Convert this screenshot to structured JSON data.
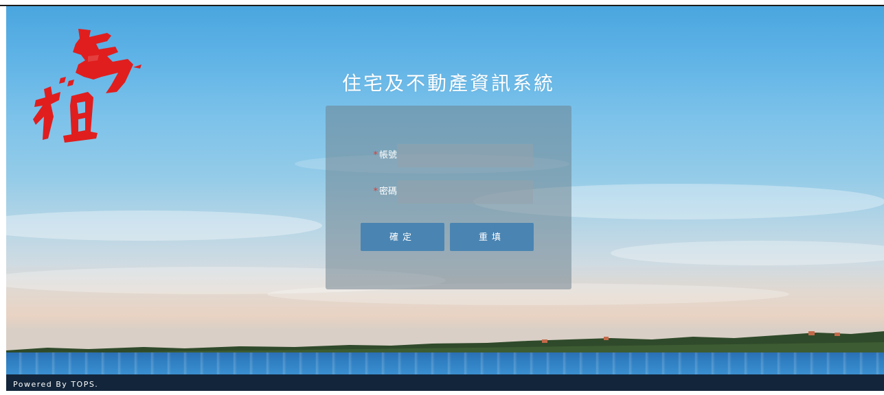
{
  "header": {
    "logo_text": "馬祖",
    "system_title": "住宅及不動產資訊系統"
  },
  "login_form": {
    "account": {
      "label": "帳號",
      "required_mark": "*",
      "value": ""
    },
    "password": {
      "label": "密碼",
      "required_mark": "*",
      "value": ""
    },
    "submit_label": "確定",
    "reset_label": "重填"
  },
  "footer": {
    "text": "Powered By TOPS."
  },
  "colors": {
    "button": "#4a84b2",
    "footer": "#13253a",
    "logo": "#e01e1e",
    "required": "#e23a32"
  }
}
